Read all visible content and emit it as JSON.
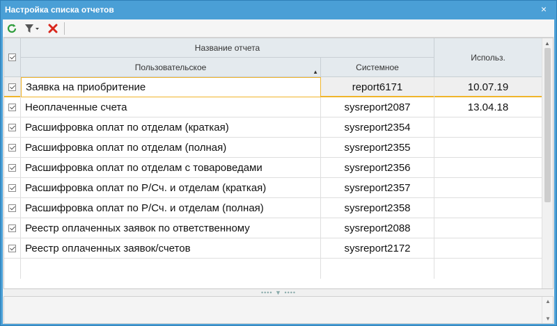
{
  "window": {
    "title": "Настройка списка отчетов"
  },
  "icons": {
    "close": "×",
    "refresh": "refresh-icon",
    "filter": "filter-icon",
    "delete": "delete-icon"
  },
  "grid": {
    "header": {
      "group": "Название отчета",
      "user_col": "Пользовательское",
      "sys_col": "Системное",
      "used_col": "Использ."
    },
    "rows": [
      {
        "name": "Заявка на приобритение",
        "sys": "report6171",
        "used": "10.07.19"
      },
      {
        "name": "Неоплаченные счета",
        "sys": "sysreport2087",
        "used": "13.04.18"
      },
      {
        "name": "Расшифровка оплат по отделам (краткая)",
        "sys": "sysreport2354",
        "used": ""
      },
      {
        "name": "Расшифровка оплат по отделам (полная)",
        "sys": "sysreport2355",
        "used": ""
      },
      {
        "name": "Расшифровка оплат по отделам с товароведами",
        "sys": "sysreport2356",
        "used": ""
      },
      {
        "name": "Расшифровка оплат по Р/Сч. и отделам (краткая)",
        "sys": "sysreport2357",
        "used": ""
      },
      {
        "name": "Расшифровка оплат по Р/Сч. и отделам (полная)",
        "sys": "sysreport2358",
        "used": ""
      },
      {
        "name": "Реестр оплаченных заявок по ответственному",
        "sys": "sysreport2088",
        "used": ""
      },
      {
        "name": "Реестр оплаченных заявок/счетов",
        "sys": "sysreport2172",
        "used": ""
      }
    ]
  },
  "splitter": {
    "grip": "•••• ▼ ••••"
  },
  "colors": {
    "title_bar": "#4a9fd6",
    "selection": "#f0b429",
    "header_bg": "#e4eaee"
  }
}
